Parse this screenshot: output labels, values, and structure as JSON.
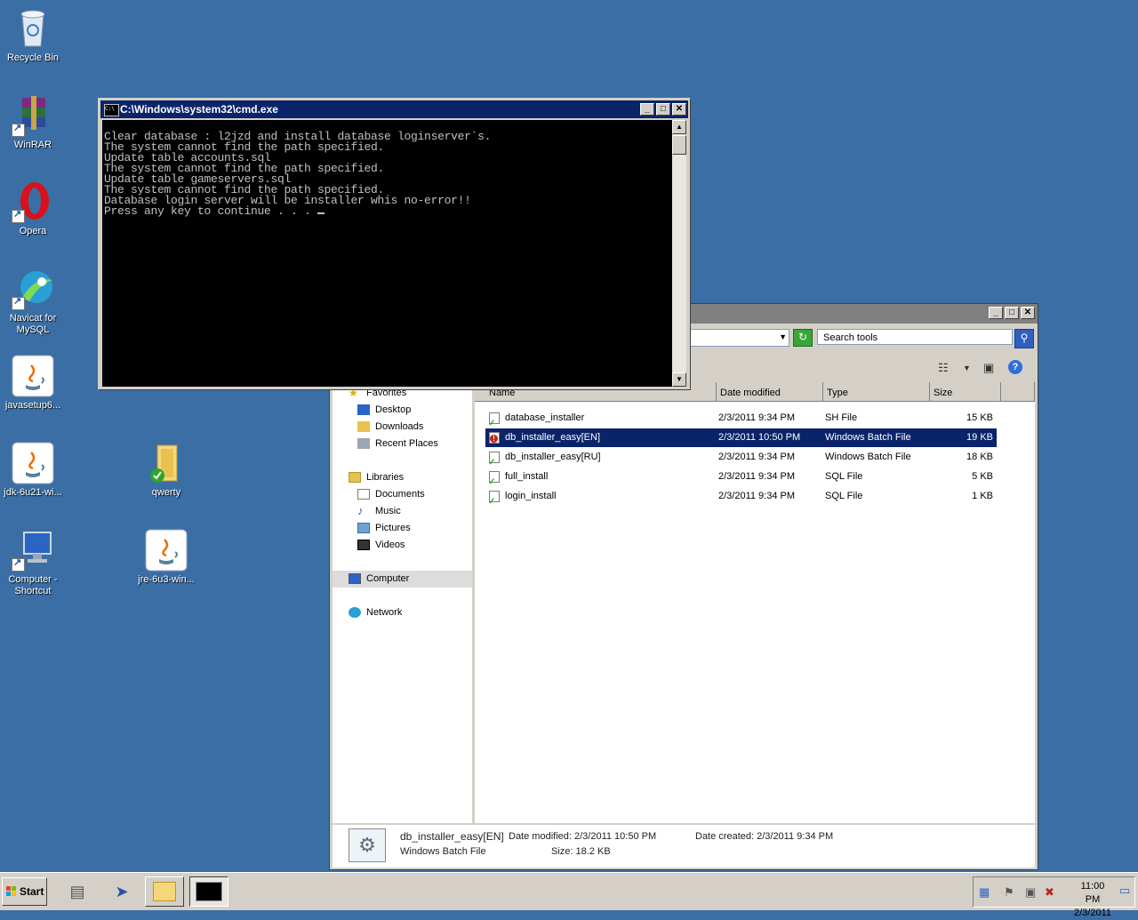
{
  "desktop": {
    "icons": [
      {
        "label": "Recycle Bin",
        "icon": "recycle-bin-icon"
      },
      {
        "label": "WinRAR",
        "icon": "winrar-icon"
      },
      {
        "label": "Opera",
        "icon": "opera-icon"
      },
      {
        "label": "Navicat for MySQL",
        "icon": "navicat-icon"
      },
      {
        "label": "javasetup6...",
        "icon": "java-icon"
      },
      {
        "label": "jdk-6u21-wi...",
        "icon": "java-icon"
      },
      {
        "label": "qwerty",
        "icon": "folder-icon"
      },
      {
        "label": "Computer - Shortcut",
        "icon": "computer-icon"
      },
      {
        "label": "jre-6u3-win...",
        "icon": "java-icon"
      }
    ]
  },
  "cmd": {
    "title": "C:\\Windows\\system32\\cmd.exe",
    "icon_text": "C:\\",
    "lines": [
      "Clear database : l2jzd and install database loginserver`s.",
      "The system cannot find the path specified.",
      "Update table accounts.sql",
      "The system cannot find the path specified.",
      "Update table gameservers.sql",
      "The system cannot find the path specified.",
      "Database login server will be installer whis no-error!!",
      "Press any key to continue . . . "
    ]
  },
  "explorer": {
    "search_placeholder": "Search tools",
    "columns": [
      "Name",
      "Date modified",
      "Type",
      "Size"
    ],
    "nav": {
      "favorites": "Favorites",
      "desktop": "Desktop",
      "downloads": "Downloads",
      "recent": "Recent Places",
      "libraries": "Libraries",
      "documents": "Documents",
      "music": "Music",
      "pictures": "Pictures",
      "videos": "Videos",
      "computer": "Computer",
      "network": "Network"
    },
    "files": [
      {
        "name": "database_installer",
        "date": "2/3/2011 9:34 PM",
        "type": "SH File",
        "size": "15 KB"
      },
      {
        "name": "db_installer_easy[EN]",
        "date": "2/3/2011 10:50 PM",
        "type": "Windows Batch File",
        "size": "19 KB"
      },
      {
        "name": "db_installer_easy[RU]",
        "date": "2/3/2011 9:34 PM",
        "type": "Windows Batch File",
        "size": "18 KB"
      },
      {
        "name": "full_install",
        "date": "2/3/2011 9:34 PM",
        "type": "SQL File",
        "size": "5 KB"
      },
      {
        "name": "login_install",
        "date": "2/3/2011 9:34 PM",
        "type": "SQL File",
        "size": "1 KB"
      }
    ],
    "details": {
      "name": "db_installer_easy[EN]",
      "type": "Windows Batch File",
      "modified": "Date modified: 2/3/2011 10:50 PM",
      "created": "Date created: 2/3/2011 9:34 PM",
      "size": "Size: 18.2 KB"
    }
  },
  "taskbar": {
    "start": "Start",
    "time": "11:00 PM",
    "date": "2/3/2011"
  },
  "colors": {
    "desktop": "#3a6ea5",
    "selection": "#0a246a"
  }
}
